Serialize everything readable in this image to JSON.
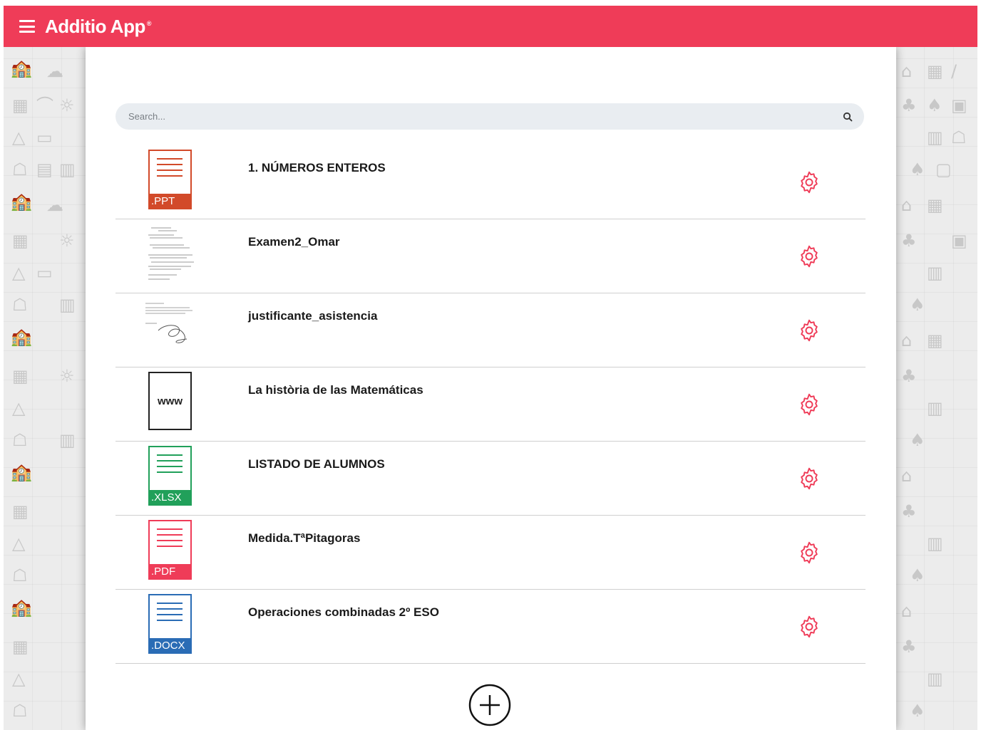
{
  "app": {
    "title": "Additio App",
    "reg": "®"
  },
  "search": {
    "placeholder": "Search..."
  },
  "colors": {
    "brand": "#ef3c58",
    "ppt": "#d24a2a",
    "xlsx": "#21a05a",
    "pdf": "#ef3c58",
    "docx": "#2a6cb5"
  },
  "files": [
    {
      "type": "ppt",
      "ext": ".PPT",
      "title": "1. NÚMEROS ENTEROS"
    },
    {
      "type": "image",
      "title": "Examen2_Omar"
    },
    {
      "type": "image",
      "title": "justificante_asistencia"
    },
    {
      "type": "link",
      "label": "www",
      "title": "La història de las Matemáticas"
    },
    {
      "type": "xlsx",
      "ext": ".XLSX",
      "title": "LISTADO DE ALUMNOS"
    },
    {
      "type": "pdf",
      "ext": ".PDF",
      "title": "Medida.TªPitagoras"
    },
    {
      "type": "docx",
      "ext": ".DOCX",
      "title": "Operaciones combinadas 2º ESO"
    }
  ],
  "icons": {
    "menu": "hamburger-menu-icon",
    "search": "search-icon",
    "settings": "gear-icon",
    "add": "plus-circle-icon"
  }
}
